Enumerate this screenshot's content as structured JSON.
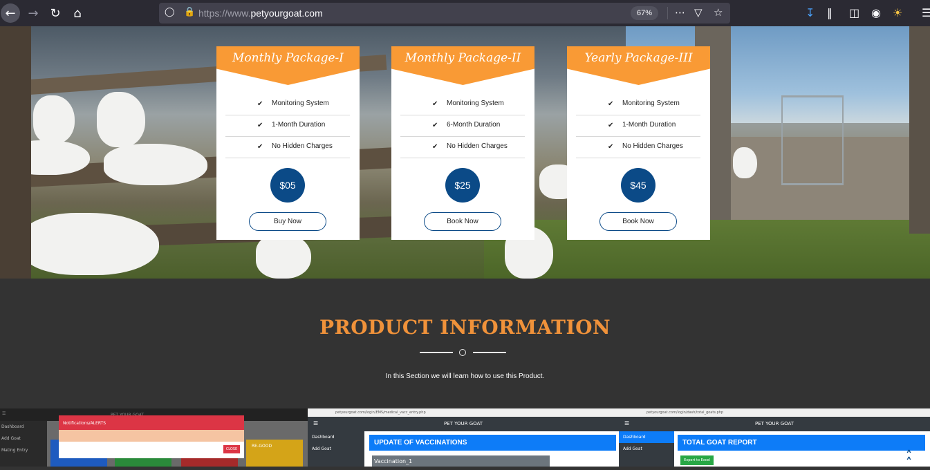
{
  "browser": {
    "url_prefix": "https://www.",
    "url_domain": "petyourgoat.com",
    "zoom": "67%",
    "icons": [
      "back-icon",
      "forward-icon",
      "reload-icon",
      "home-icon",
      "shield-icon",
      "lock-icon",
      "more-icon",
      "pocket-icon",
      "star-icon",
      "download-icon",
      "library-icon",
      "sidebar-icon",
      "account-icon",
      "sun-icon",
      "menu-icon"
    ]
  },
  "packages": [
    {
      "title": "Monthly Package-I",
      "features": [
        "Monitoring System",
        "1-Month Duration",
        "No Hidden Charges"
      ],
      "price": "$05",
      "button": "Buy Now"
    },
    {
      "title": "Monthly Package-II",
      "features": [
        "Monitoring System",
        "6-Month Duration",
        "No Hidden Charges"
      ],
      "price": "$25",
      "button": "Book Now"
    },
    {
      "title": "Yearly Package-III",
      "features": [
        "Monitoring System",
        "1-Month Duration",
        "No Hidden Charges"
      ],
      "price": "$45",
      "button": "Book Now"
    }
  ],
  "product_info": {
    "title": "PRODUCT INFORMATION",
    "subtitle": "In this Section we will learn how to use this Product."
  },
  "screenshots": {
    "shot1": {
      "app_title": "PET YOUR GOAT",
      "side_items": [
        "Dashboard",
        "Add Goat",
        "Mating Entry"
      ],
      "modal_title": "Notifications/ALERTS",
      "modal_close": "CLOSE",
      "tiles": [
        "of Goat",
        "GOAT",
        "RE-GOOD"
      ]
    },
    "shot2": {
      "url": "petyourgoat.com/login/EMS/medical_vacc_entry.php",
      "app_title": "PET YOUR GOAT",
      "side_items": [
        "Dashboard",
        "Add Goat"
      ],
      "header": "UPDATE OF VACCINATIONS",
      "field": "Vaccination_1"
    },
    "shot3": {
      "url": "petyourgoat.com/login/dash/total_goats.php",
      "app_title": "PET YOUR GOAT",
      "side_items": [
        "Dashboard",
        "Add Goat"
      ],
      "header": "TOTAL GOAT REPORT",
      "button": "Export to Excel"
    }
  },
  "colors": {
    "accent_orange": "#f99a35",
    "price_blue": "#0b4a87",
    "section_bg": "#333333",
    "title_orange": "#f0923a"
  }
}
